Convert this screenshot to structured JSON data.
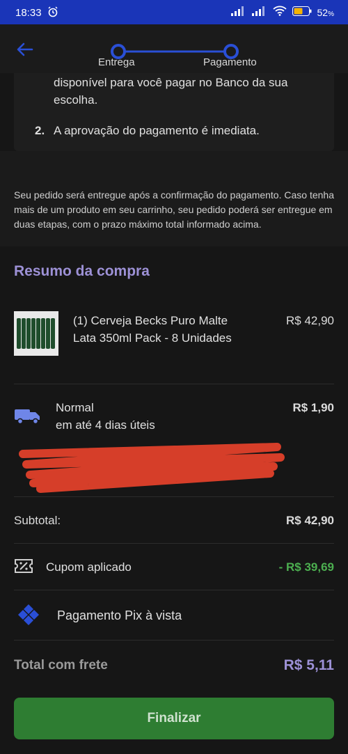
{
  "status": {
    "time": "18:33",
    "battery": "52"
  },
  "steps": {
    "first": "Entrega",
    "second": "Pagamento"
  },
  "payment_info": {
    "line1": "disponível para você pagar no Banco da sua",
    "line2": "escolha.",
    "item2_num": "2.",
    "item2_text": "A aprovação do pagamento é imediata."
  },
  "notice": "Seu pedido será entregue após a confirmação do pagamento. Caso tenha mais de um produto em seu carrinho, seu pedido poderá ser entregue em duas etapas, com o prazo máximo total informado acima.",
  "summary": {
    "title": "Resumo da compra",
    "product_line1": "(1) Cerveja Becks Puro Malte",
    "product_line2": "Lata 350ml Pack - 8 Unidades",
    "product_price": "R$ 42,90",
    "shipping_name": "Normal",
    "shipping_eta": "em até 4 dias úteis",
    "shipping_price": "R$ 1,90",
    "subtotal_label": "Subtotal:",
    "subtotal_value": "R$ 42,90",
    "coupon_label": "Cupom aplicado",
    "coupon_value": "- R$ 39,69",
    "payment_label": "Pagamento Pix à vista",
    "total_label": "Total com frete",
    "total_value": "R$ 5,11"
  },
  "finalize_label": "Finalizar",
  "colors": {
    "accent": "#9d91d6",
    "primary_blue": "#1a35b8",
    "discount_green": "#4caf50",
    "button_green": "#2e7d32"
  }
}
